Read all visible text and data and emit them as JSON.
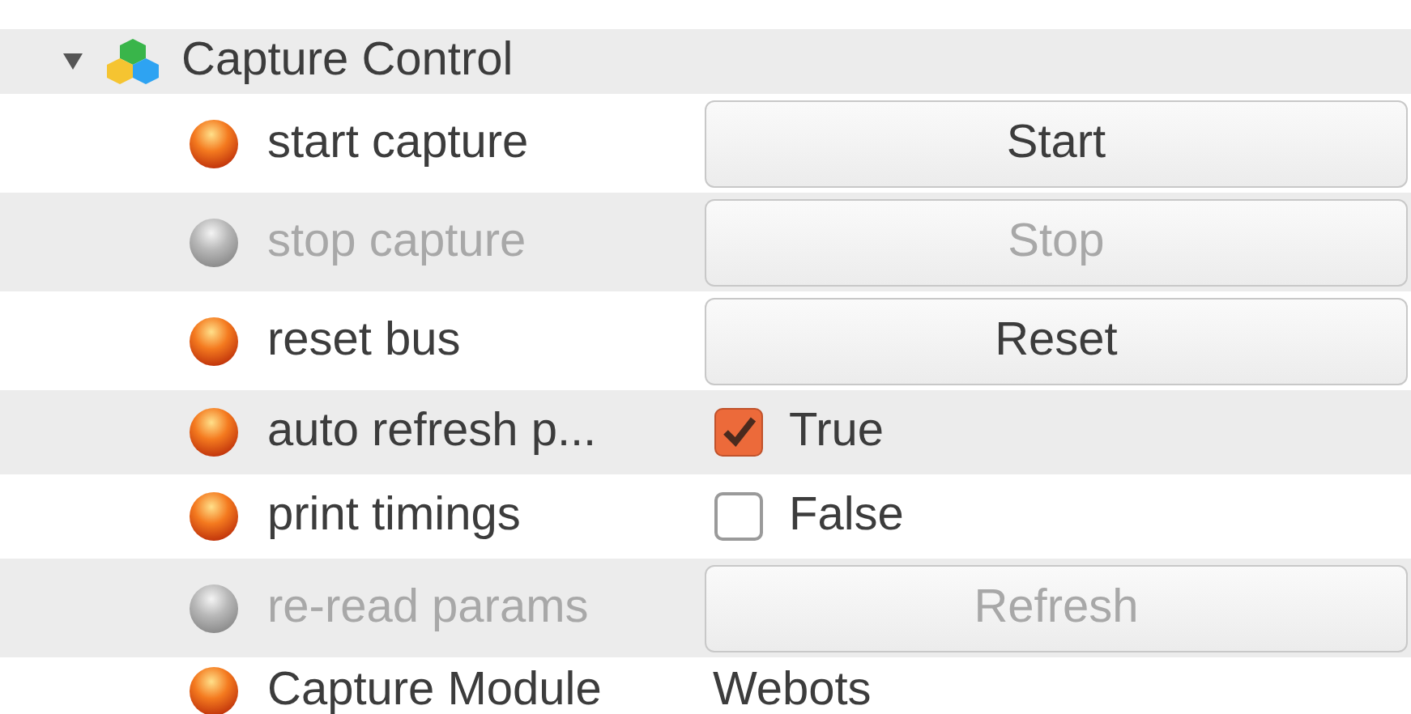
{
  "group": {
    "title": "Capture Control",
    "expanded": true
  },
  "rows": [
    {
      "label": "start capture",
      "enabled": true,
      "kind": "button",
      "value": "Start"
    },
    {
      "label": "stop capture",
      "enabled": false,
      "kind": "button",
      "value": "Stop"
    },
    {
      "label": "reset bus",
      "enabled": true,
      "kind": "button",
      "value": "Reset"
    },
    {
      "label": "auto refresh p...",
      "enabled": true,
      "kind": "checkbox",
      "value": "True",
      "checked": true
    },
    {
      "label": "print timings",
      "enabled": true,
      "kind": "checkbox",
      "value": "False",
      "checked": false
    },
    {
      "label": "re-read params",
      "enabled": false,
      "kind": "button",
      "value": "Refresh"
    },
    {
      "label": "Capture Module",
      "enabled": true,
      "kind": "text",
      "value": "Webots"
    }
  ]
}
